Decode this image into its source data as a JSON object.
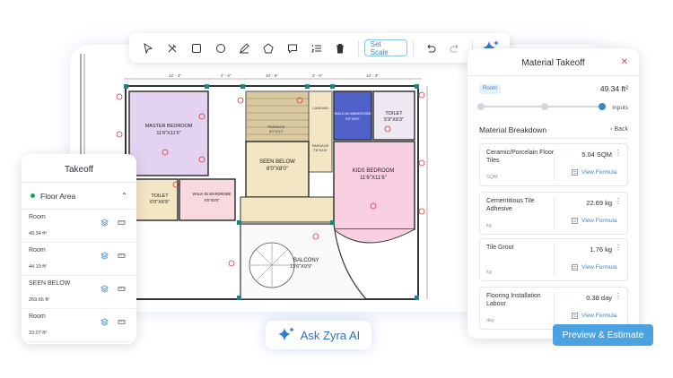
{
  "toolbar": {
    "set_scale_label": "Set Scale",
    "tools": [
      "select-tool",
      "node-edit-tool",
      "rectangle-tool",
      "circle-tool",
      "pen-tool",
      "polygon-tool",
      "comment-tool",
      "list-tool",
      "delete-tool"
    ],
    "undo": "undo-icon",
    "redo": "redo-icon",
    "ai": "sparkle-icon"
  },
  "plan": {
    "rooms": [
      {
        "name": "MASTER BEDROOM",
        "size": "11'6\"X11'6\""
      },
      {
        "name": "SEEN BELOW",
        "size": "8'0\"X8'0\""
      },
      {
        "name": "KIDS BEDROOM",
        "size": "11'6\"X11'6\""
      },
      {
        "name": "TOILET",
        "size": "6'0\"X6'9\""
      },
      {
        "name": "TOILET",
        "size": "5'9\"X6'3\""
      },
      {
        "name": "WALK-IN WARDROBE",
        "size": "6'6\"X5'9\""
      },
      {
        "name": "WALK-IN WARDROBE",
        "size": "5'0\"X6'0\""
      },
      {
        "name": "BALCONY",
        "size": "13'6\"X9'9\""
      },
      {
        "name": "PASSAGE",
        "size": "8'0\"X3'3\""
      },
      {
        "name": "PASSAGE",
        "size": "7'6\"X4'6\""
      },
      {
        "name": "LANDING",
        "size": ""
      }
    ],
    "dims": [
      "12' - 3\"",
      "2' - 6\"",
      "10' - 6\"",
      "2' - 6\"",
      "12' - 3\"",
      "2' - 10\"",
      "1' - 10\"",
      "6\"",
      "3' - 10\"",
      "2' - 10\""
    ]
  },
  "takeoff": {
    "title": "Takeoff",
    "group": "Floor Area",
    "items": [
      {
        "name": "Room",
        "value": "49.34 ft²"
      },
      {
        "name": "Room",
        "value": "44.19 ft²"
      },
      {
        "name": "SEEN BELOW",
        "value": "269.66 ft²"
      },
      {
        "name": "Room",
        "value": "33.07 ft²"
      }
    ]
  },
  "material": {
    "title": "Material Takeoff",
    "room_label": "Room",
    "room_value": "49.34 ft²",
    "inputs_label": "Inputs",
    "breakdown_title": "Material Breakdown",
    "back_label": "Back",
    "view_formula": "View Formula",
    "cards": [
      {
        "name": "Ceramic/Porcelain Floor Tiles",
        "value": "5.04 SQM",
        "unit": "SQM"
      },
      {
        "name": "Cementitious Tile Adhesive",
        "value": "22.69 kg",
        "unit": "kg"
      },
      {
        "name": "Tile Grout",
        "value": "1.76 kg",
        "unit": "kg"
      },
      {
        "name": "Flooring Installation Labour",
        "value": "0.38 day",
        "unit": "day"
      }
    ]
  },
  "preview_label": "Preview & Estimate",
  "ai_label": "Ask Zyra AI",
  "colors": {
    "accent": "#4aa2e0",
    "purple": "#e3d2f0",
    "pink": "#f7cfe0",
    "blue": "#5062c8",
    "beige": "#f3e6c4"
  }
}
